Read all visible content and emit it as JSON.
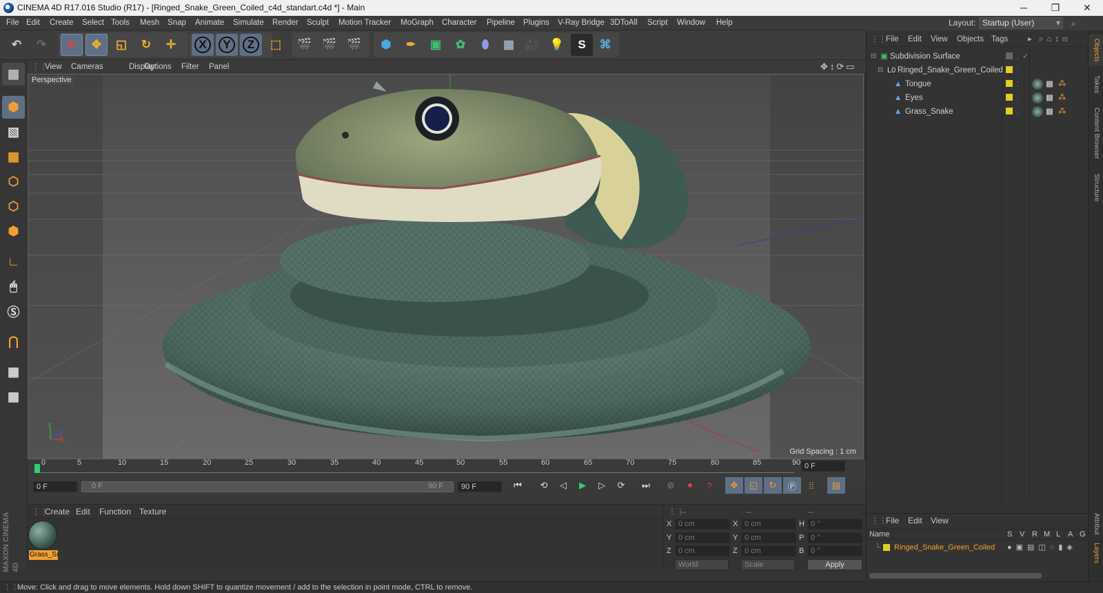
{
  "window": {
    "title": "CINEMA 4D R17.016 Studio (R17) - [Ringed_Snake_Green_Coiled_c4d_standart.c4d *] - Main",
    "controls": [
      "─",
      "❐",
      "✕"
    ]
  },
  "menubar": {
    "items": [
      "File",
      "Edit",
      "Create",
      "Select",
      "Tools",
      "Mesh",
      "Snap",
      "Animate",
      "Simulate",
      "Render",
      "Sculpt",
      "Motion Tracker",
      "MoGraph",
      "Character",
      "Pipeline",
      "Plugins",
      "V-Ray Bridge",
      "3DToAll",
      "Script",
      "Window",
      "Help"
    ]
  },
  "layout": {
    "label": "Layout:",
    "value": "Startup (User)"
  },
  "toolbar": {
    "axis_x": "X",
    "axis_y": "Y",
    "axis_z": "Z"
  },
  "viewport": {
    "menu": [
      "View",
      "Cameras",
      "Display",
      "Options",
      "Filter",
      "Panel"
    ],
    "label": "Perspective",
    "grid_spacing": "Grid Spacing : 1 cm",
    "axis_labels": {
      "y": "Y",
      "x": "X",
      "z": "Z"
    }
  },
  "timeline": {
    "ticks": [
      "0",
      "5",
      "10",
      "15",
      "20",
      "25",
      "30",
      "35",
      "40",
      "45",
      "50",
      "55",
      "60",
      "65",
      "70",
      "75",
      "80",
      "85",
      "90"
    ],
    "frame_field": "0 F"
  },
  "transport": {
    "start": "0 F",
    "slider_start": "0 F",
    "slider_end": "90 F",
    "end": "90 F"
  },
  "material_manager": {
    "menu": [
      "Create",
      "Edit",
      "Function",
      "Texture"
    ],
    "materials": [
      {
        "name": "Grass_Sı"
      }
    ],
    "logo_text": "MAXON CINEMA 4D"
  },
  "coordinates": {
    "header": [
      "--",
      "--",
      "--"
    ],
    "rows": [
      {
        "l1": "X",
        "v1": "0 cm",
        "l2": "X",
        "v2": "0 cm",
        "l3": "H",
        "v3": "0 °"
      },
      {
        "l1": "Y",
        "v1": "0 cm",
        "l2": "Y",
        "v2": "0 cm",
        "l3": "P",
        "v3": "0 °"
      },
      {
        "l1": "Z",
        "v1": "0 cm",
        "l2": "Z",
        "v2": "0 cm",
        "l3": "B",
        "v3": "0 °"
      }
    ],
    "world": "World",
    "scale": "Scale",
    "apply": "Apply"
  },
  "object_manager": {
    "menu": [
      "File",
      "Edit",
      "View",
      "Objects",
      "Tags"
    ],
    "objects": [
      {
        "name": "Subdivision Surface"
      },
      {
        "name": "Ringed_Snake_Green_Coiled"
      },
      {
        "name": "Tongue"
      },
      {
        "name": "Eyes"
      },
      {
        "name": "Grass_Snake"
      }
    ]
  },
  "layer_manager": {
    "menu": [
      "File",
      "Edit",
      "View"
    ],
    "columns": [
      "Name",
      "S",
      "V",
      "R",
      "M",
      "L",
      "A",
      "G"
    ],
    "row": "Ringed_Snake_Green_Coiled"
  },
  "right_tabs": [
    "Objects",
    "Takes",
    "Content Browser",
    "Structure",
    "Attributes",
    "Layers"
  ],
  "statusbar": {
    "text": "Move: Click and drag to move elements. Hold down SHIFT to quantize movement / add to the selection in point mode, CTRL to remove."
  },
  "colors": {
    "accent": "#f0a030",
    "selection": "#5f6f86",
    "layer_yellow": "#e0d020"
  }
}
